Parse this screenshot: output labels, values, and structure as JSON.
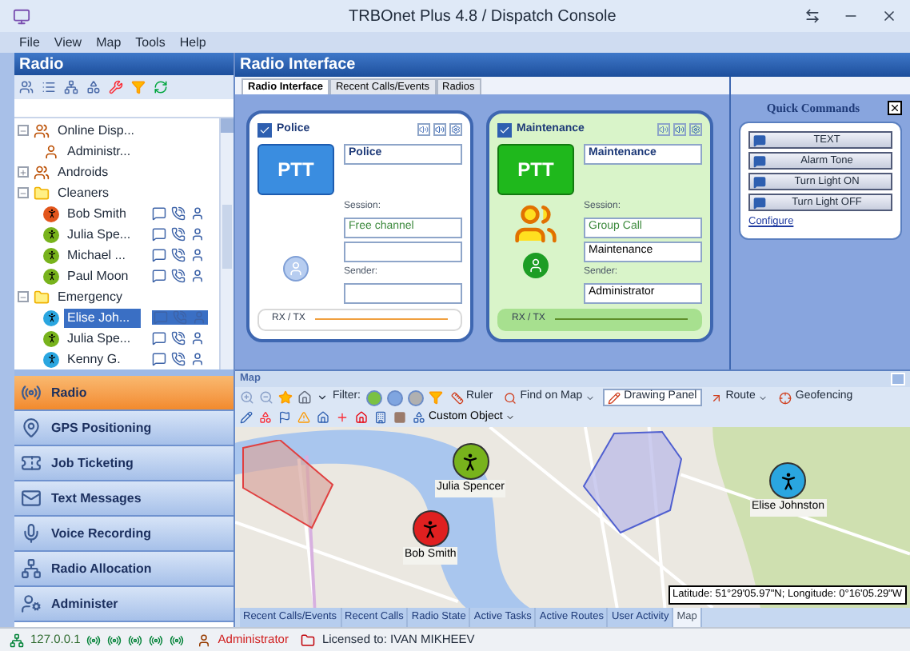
{
  "window": {
    "title": "TRBOnet Plus 4.8 / Dispatch Console"
  },
  "menu": [
    "File",
    "View",
    "Map",
    "Tools",
    "Help"
  ],
  "radio_panel": {
    "title": "Radio",
    "tree": [
      {
        "label": "Online Disp...",
        "kind": "team",
        "expanded": true,
        "children": [
          {
            "label": "Administr...",
            "kind": "dispatcher",
            "selected": false
          }
        ]
      },
      {
        "label": "Androids",
        "kind": "team",
        "expanded": false
      },
      {
        "label": "Cleaners",
        "kind": "folder",
        "expanded": true,
        "children": [
          {
            "label": "Bob Smith",
            "kind": "radio",
            "color": "#e2561c",
            "selected": false
          },
          {
            "label": "Julia Spe...",
            "kind": "radio",
            "color": "#78b31c",
            "selected": false
          },
          {
            "label": "Michael ...",
            "kind": "radio",
            "color": "#78b31c",
            "selected": false
          },
          {
            "label": "Paul Moon",
            "kind": "radio",
            "color": "#78b31c",
            "selected": false
          }
        ]
      },
      {
        "label": "Emergency",
        "kind": "folder",
        "expanded": true,
        "children": [
          {
            "label": "Elise Joh...",
            "kind": "radio",
            "color": "#2aa6e0",
            "selected": true
          },
          {
            "label": "Julia Spe...",
            "kind": "radio",
            "color": "#78b31c",
            "selected": false
          },
          {
            "label": "Kenny G.",
            "kind": "radio",
            "color": "#2aa6e0",
            "selected": false
          }
        ]
      }
    ],
    "nav": [
      {
        "label": "Radio",
        "selected": true
      },
      {
        "label": "GPS Positioning",
        "selected": false
      },
      {
        "label": "Job Ticketing",
        "selected": false
      },
      {
        "label": "Text Messages",
        "selected": false
      },
      {
        "label": "Voice Recording",
        "selected": false
      },
      {
        "label": "Radio Allocation",
        "selected": false
      },
      {
        "label": "Administer",
        "selected": false
      }
    ]
  },
  "radio_interface": {
    "title": "Radio Interface",
    "tabs": [
      {
        "label": "Radio Interface",
        "selected": true
      },
      {
        "label": "Recent Calls/Events",
        "selected": false
      },
      {
        "label": "Radios",
        "selected": false
      }
    ],
    "cards": [
      {
        "title": "Police",
        "checked": true,
        "active": false,
        "ptt": "PTT",
        "name": "Police",
        "session_label": "Session:",
        "session": "Free channel",
        "sender_label": "Sender:",
        "rxtx": "RX / TX"
      },
      {
        "title": "Maintenance",
        "checked": true,
        "active": true,
        "ptt": "PTT",
        "name": "Maintenance",
        "session_label": "Session:",
        "session": "Group Call",
        "group": "Maintenance",
        "sender_label": "Sender:",
        "sender": "Administrator",
        "rxtx": "RX / TX"
      }
    ],
    "quick_commands": {
      "title": "Quick Commands",
      "commands": [
        "TEXT",
        "Alarm Tone",
        "Turn Light ON",
        "Turn Light OFF"
      ],
      "link": "Configure"
    }
  },
  "map": {
    "title": "Map",
    "toolbar": [
      {
        "kind": "label",
        "label": "Filter:"
      },
      {
        "kind": "button",
        "label": "Ruler",
        "selected": false
      },
      {
        "kind": "dropdown",
        "label": "Find on Map",
        "selected": false
      },
      {
        "kind": "button",
        "label": "Drawing Panel",
        "selected": true
      },
      {
        "kind": "dropdown",
        "label": "Route",
        "selected": false
      },
      {
        "kind": "button",
        "label": "Geofencing",
        "selected": false
      }
    ],
    "custom_object": "Custom Object",
    "markers": [
      {
        "label": "Julia Spencer",
        "color": "#78b31c"
      },
      {
        "label": "Elise Johnston",
        "color": "#2aa6e0"
      },
      {
        "label": "Bob Smith",
        "color": "#e02020"
      }
    ],
    "coordinates": "Latitude: 51°29'05.97\"N; Longitude: 0°16'05.29\"W",
    "tabs": [
      {
        "label": "Recent Calls/Events",
        "selected": false
      },
      {
        "label": "Recent Calls",
        "selected": false
      },
      {
        "label": "Radio State",
        "selected": false
      },
      {
        "label": "Active Tasks",
        "selected": false
      },
      {
        "label": "Active Routes",
        "selected": false
      },
      {
        "label": "User Activity",
        "selected": false
      },
      {
        "label": "Map",
        "selected": true
      }
    ]
  },
  "status_bar": {
    "address": "127.0.0.1",
    "user": "Administrator",
    "license": "Licensed to: IVAN MIKHEEV"
  }
}
